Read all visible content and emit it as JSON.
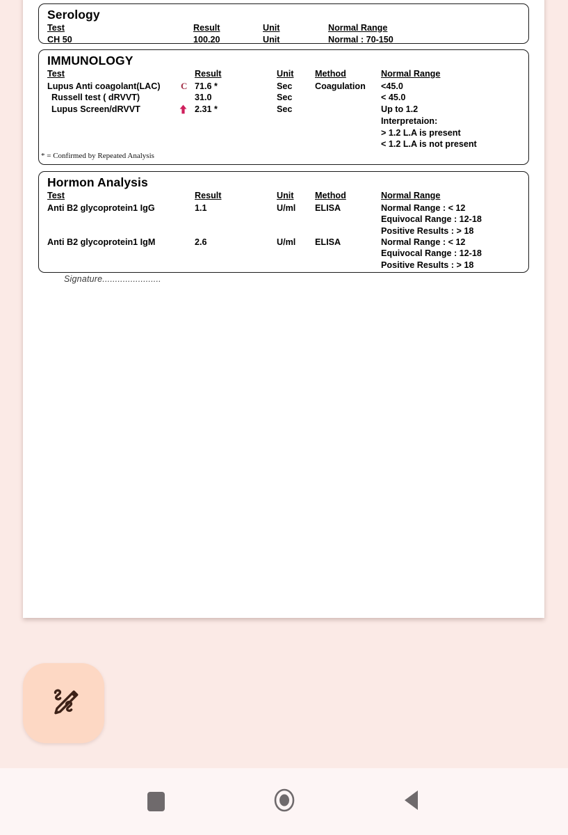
{
  "document": {
    "sections": [
      {
        "title": "Serology",
        "columns": [
          "Test",
          "Result",
          "Unit",
          "Normal Range"
        ],
        "rows": [
          {
            "test": "CH 50",
            "result": "100.20",
            "unit": "Unit",
            "normal_range": [
              "Normal : 70-150"
            ]
          }
        ]
      },
      {
        "title": "IMMUNOLOGY",
        "columns": [
          "Test",
          "Result",
          "Unit",
          "Method",
          "Normal Range"
        ],
        "rows": [
          {
            "test": "Lupus Anti coagolant(LAC)",
            "flag": "C",
            "result": "71.6 *",
            "unit": "Sec",
            "method": "Coagulation",
            "normal_range": [
              "<45.0"
            ]
          },
          {
            "test": "Russell test ( dRVVT)",
            "flag": "",
            "result": "31.0",
            "unit": "Sec",
            "method": "",
            "normal_range": [
              "< 45.0"
            ]
          },
          {
            "test": "Lupus Screen/dRVVT",
            "flag": "up-arrow",
            "result": "2.31 *",
            "unit": "Sec",
            "method": "",
            "normal_range": [
              "Up to 1.2",
              "Interpretaion:",
              "> 1.2 L.A is present",
              "< 1.2 L.A is not present"
            ]
          }
        ],
        "footnote": "* = Confirmed by Repeated Analysis"
      },
      {
        "title": "Hormon Analysis",
        "columns": [
          "Test",
          "Result",
          "Unit",
          "Method",
          "Normal Range"
        ],
        "rows": [
          {
            "test": "Anti B2 glycoprotein1 IgG",
            "result": "1.1",
            "unit": "U/ml",
            "method": "ELISA",
            "normal_range": [
              "Normal Range : < 12",
              "Equivocal Range : 12-18",
              "Positive Results : > 18"
            ]
          },
          {
            "test": "Anti B2 glycoprotein1 IgM",
            "result": "2.6",
            "unit": "U/ml",
            "method": "ELISA",
            "normal_range": [
              "Normal Range : < 12",
              "Equivocal Range : 12-18",
              "Positive Results : > 18"
            ]
          }
        ]
      }
    ],
    "signature_label": "Signature......................."
  },
  "fab": {
    "icon": "edit-markup-icon"
  },
  "navbar": {
    "recents_icon": "square-recents-icon",
    "home_icon": "circle-home-icon",
    "back_icon": "triangle-back-icon"
  },
  "colors": {
    "background": "#fbeae6",
    "page": "#ffffff",
    "navbar": "#fdf5f5",
    "fab": "#fdd8c4",
    "flag_c": "#a33048",
    "flag_arrow": "#cf1f5c",
    "nav_icon": "#6f6a6c",
    "border": "#1a1a1a"
  }
}
